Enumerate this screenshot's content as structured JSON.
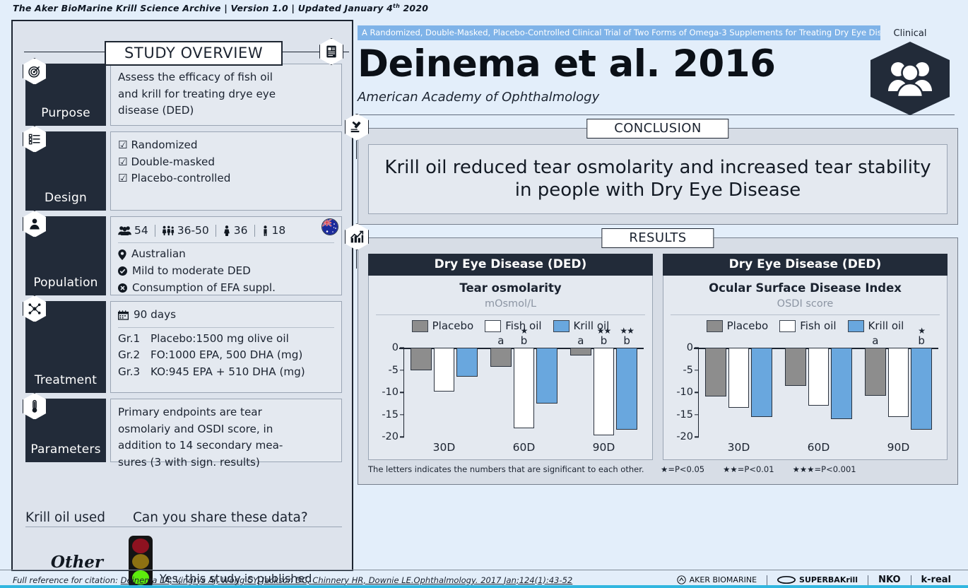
{
  "archive": {
    "text_before": "The Aker BioMarine Krill Science Archive | Version 1.0 | Updated January 4",
    "sup": "th",
    "text_after": " 2020"
  },
  "left_panel": {
    "title": "STUDY OVERVIEW",
    "title_icon": "document-icon",
    "rows": [
      {
        "label": "Purpose",
        "icon": "target-icon",
        "lines": [
          "Assess the efficacy of fish oil",
          "and krill for treating drye eye",
          "disease (DED)"
        ]
      },
      {
        "label": "Design",
        "icon": "checklist-icon",
        "lines": [
          "☑ Randomized",
          "☑ Double-masked",
          "☑ Placebo-controlled"
        ]
      },
      {
        "label": "Population",
        "icon": "person-icon",
        "stats": [
          {
            "icon": "group-icon",
            "value": "54"
          },
          {
            "icon": "people-range-icon",
            "value": "36-50"
          },
          {
            "icon": "female-icon",
            "value": "36"
          },
          {
            "icon": "male-icon",
            "value": "18"
          }
        ],
        "flag": "australia-flag-icon",
        "bullets": [
          {
            "icon": "location-pin-icon",
            "text": "Australian"
          },
          {
            "icon": "check-circle-icon",
            "text": "Mild to moderate DED"
          },
          {
            "icon": "x-circle-icon",
            "text": "Consumption of EFA suppl."
          }
        ]
      },
      {
        "label": "Treatment",
        "icon": "molecule-icon",
        "duration_icon": "calendar-icon",
        "duration": "90 days",
        "groups": [
          {
            "gr": "Gr.1",
            "text": "Placebo:1500 mg olive oil"
          },
          {
            "gr": "Gr.2",
            "text": "FO:1000 EPA, 500 DHA (mg)"
          },
          {
            "gr": "Gr.3",
            "text": "KO:945 EPA + 510 DHA (mg)"
          }
        ]
      },
      {
        "label": "Parameters",
        "icon": "thermometer-icon",
        "lines": [
          "Primary endpoints are tear",
          "osmolariy and OSDI score, in",
          "addition to 14 secondary mea-",
          "sures (3 with sign. results)"
        ]
      }
    ],
    "bottom": {
      "krill_used_header": "Krill oil used",
      "share_header": "Can you share these data?",
      "krill_used_value": "Other",
      "traffic_light_icon": "traffic-light-icon",
      "share_answer": "Yes, this study is published",
      "traffic_colors": {
        "red": "#8e1220",
        "amber": "#8d7112",
        "green": "#5dec0d"
      }
    }
  },
  "header": {
    "subtitle": "A Randomized, Double-Masked, Placebo-Controlled Clinical Trial of Two Forms of Omega-3 Supplements for Treating Dry Eye Disease",
    "title": "Deinema et al. 2016",
    "journal": "American Academy of Ophthalmology",
    "badge_label": "Clinical",
    "badge_icon": "people-group-icon",
    "subtitle_band_color": "#7fb3e8"
  },
  "conclusion": {
    "section_title": "CONCLUSION",
    "section_icon": "gavel-icon",
    "text": "Krill oil reduced tear osmolarity and increased tear stability in people with Dry Eye Disease"
  },
  "results": {
    "section_title": "RESULTS",
    "section_icon": "bar-chart-icon",
    "note_letters": "The letters indicates the numbers that are significant to each other.",
    "significance": [
      {
        "stars": "★",
        "text": "=P<0.05"
      },
      {
        "stars": "★★",
        "text": "=P<0.01"
      },
      {
        "stars": "★★★",
        "text": "=P<0.001"
      }
    ]
  },
  "chart_data": [
    {
      "type": "bar",
      "card_header": "Dry Eye Disease (DED)",
      "title": "Tear osmolarity",
      "subtitle": "mOsmol/L",
      "xlabel": "",
      "ylabel": "",
      "categories": [
        "30D",
        "60D",
        "90D"
      ],
      "ylim": [
        -20,
        0
      ],
      "yticks": [
        0,
        -5,
        -10,
        -15,
        -20
      ],
      "legend_position": "top",
      "series": [
        {
          "name": "Placebo",
          "color": "#8d8d8d",
          "values": [
            -5.1,
            -4.2,
            -1.7
          ]
        },
        {
          "name": "Fish oil",
          "color": "#ffffff",
          "values": [
            -9.8,
            -18.0,
            -19.7
          ]
        },
        {
          "name": "Krill oil",
          "color": "#69a7de",
          "values": [
            -6.5,
            -12.5,
            -18.4
          ]
        }
      ],
      "annotations": [
        {
          "group": "30D",
          "series": "Placebo",
          "letter": "",
          "stars": ""
        },
        {
          "group": "30D",
          "series": "Fish oil",
          "letter": "",
          "stars": ""
        },
        {
          "group": "30D",
          "series": "Krill oil",
          "letter": "",
          "stars": ""
        },
        {
          "group": "60D",
          "series": "Placebo",
          "letter": "a",
          "stars": ""
        },
        {
          "group": "60D",
          "series": "Fish oil",
          "letter": "b",
          "stars": "★"
        },
        {
          "group": "60D",
          "series": "Krill oil",
          "letter": "",
          "stars": ""
        },
        {
          "group": "90D",
          "series": "Placebo",
          "letter": "a",
          "stars": ""
        },
        {
          "group": "90D",
          "series": "Fish oil",
          "letter": "b",
          "stars": "★★"
        },
        {
          "group": "90D",
          "series": "Krill oil",
          "letter": "b",
          "stars": "★★"
        }
      ]
    },
    {
      "type": "bar",
      "card_header": "Dry Eye Disease (DED)",
      "title": "Ocular Surface Disease Index",
      "subtitle": "OSDI score",
      "xlabel": "",
      "ylabel": "",
      "categories": [
        "30D",
        "60D",
        "90D"
      ],
      "ylim": [
        -20,
        0
      ],
      "yticks": [
        0,
        -5,
        -10,
        -15,
        -20
      ],
      "legend_position": "top",
      "series": [
        {
          "name": "Placebo",
          "color": "#8d8d8d",
          "values": [
            -11.0,
            -8.6,
            -10.7
          ]
        },
        {
          "name": "Fish oil",
          "color": "#ffffff",
          "values": [
            -13.5,
            -13.0,
            -15.5
          ]
        },
        {
          "name": "Krill oil",
          "color": "#69a7de",
          "values": [
            -15.5,
            -16.0,
            -18.4
          ]
        }
      ],
      "annotations": [
        {
          "group": "30D",
          "series": "Placebo",
          "letter": "",
          "stars": ""
        },
        {
          "group": "30D",
          "series": "Fish oil",
          "letter": "",
          "stars": ""
        },
        {
          "group": "30D",
          "series": "Krill oil",
          "letter": "",
          "stars": ""
        },
        {
          "group": "60D",
          "series": "Placebo",
          "letter": "",
          "stars": ""
        },
        {
          "group": "60D",
          "series": "Fish oil",
          "letter": "",
          "stars": ""
        },
        {
          "group": "60D",
          "series": "Krill oil",
          "letter": "",
          "stars": ""
        },
        {
          "group": "90D",
          "series": "Placebo",
          "letter": "a",
          "stars": ""
        },
        {
          "group": "90D",
          "series": "Fish oil",
          "letter": "",
          "stars": ""
        },
        {
          "group": "90D",
          "series": "Krill oil",
          "letter": "b",
          "stars": "★"
        }
      ]
    }
  ],
  "footer": {
    "label": "Full reference for citation:",
    "reference": "Deinema LA, Vingrys AJ, Wong CY, Jackson DC, Chinnery HR, Downie LE.Ophthalmology. 2017 Jan;124(1):43-52",
    "brands": [
      "AKER BIOMARINE",
      "SUPERBAKrill",
      "NKO",
      "k-real"
    ]
  }
}
